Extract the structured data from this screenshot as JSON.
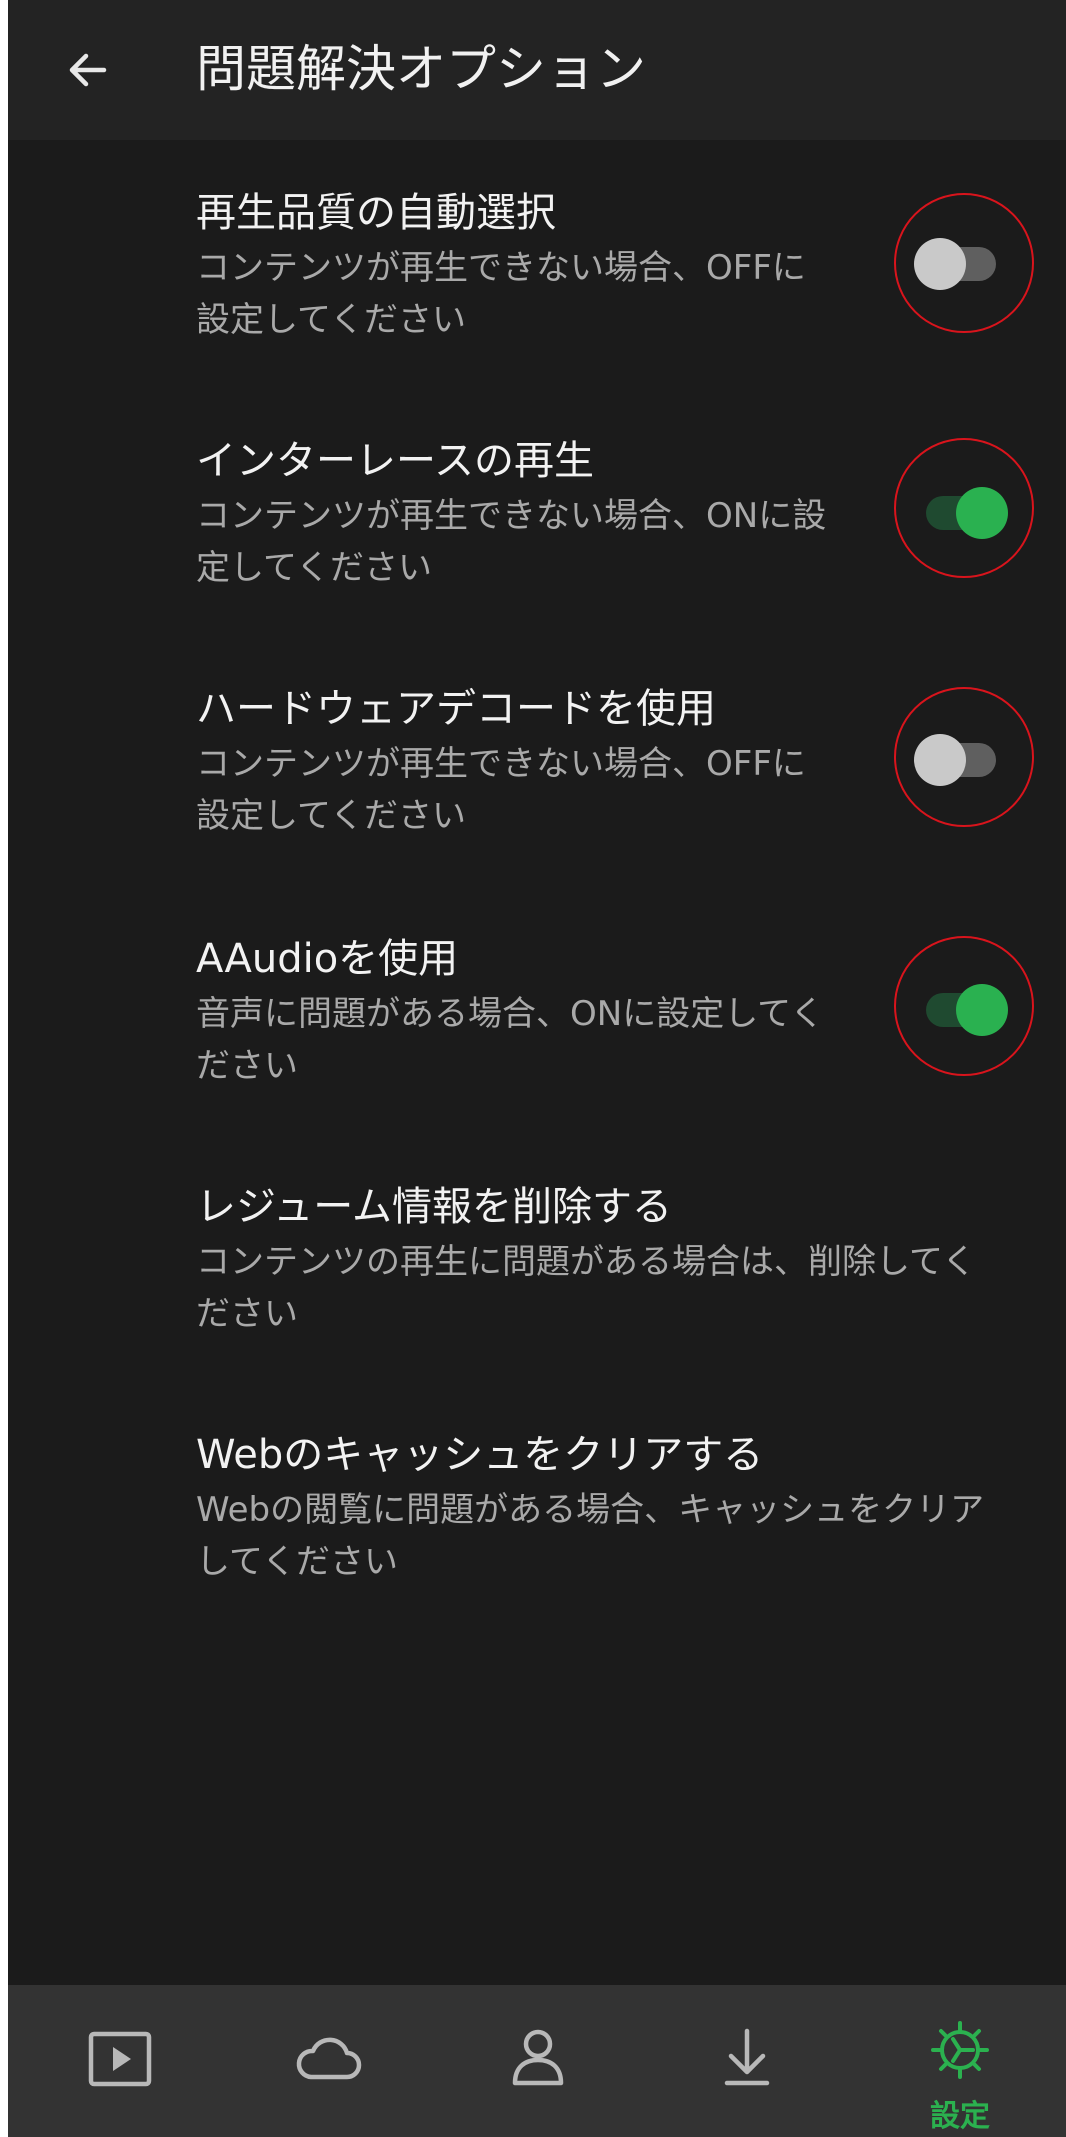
{
  "header": {
    "title": "問題解決オプション",
    "back_icon": "arrow-left-icon"
  },
  "settings": [
    {
      "label": "再生品質の自動選択",
      "description": "コンテンツが再生できない場合、OFFに設定してください",
      "toggle": "off"
    },
    {
      "label": "インターレースの再生",
      "description": "コンテンツが再生できない場合、ONに設定してください",
      "toggle": "on"
    },
    {
      "label": "ハードウェアデコードを使用",
      "description": "コンテンツが再生できない場合、OFFに設定してください",
      "toggle": "off"
    },
    {
      "label": "AAudioを使用",
      "description": "音声に問題がある場合、ONに設定してください",
      "toggle": "on"
    },
    {
      "label": "レジューム情報を削除する",
      "description": "コンテンツの再生に問題がある場合は、削除してください"
    },
    {
      "label": "Webのキャッシュをクリアする",
      "description": "Webの閲覧に問題がある場合、キャッシュをクリアしてください"
    }
  ],
  "bottom_nav": {
    "items": [
      {
        "icon": "play-icon"
      },
      {
        "icon": "cloud-icon"
      },
      {
        "icon": "person-icon"
      },
      {
        "icon": "download-icon"
      },
      {
        "icon": "settings-gear-icon",
        "label": "設定",
        "active": true
      }
    ]
  },
  "colors": {
    "accent": "#2ab150",
    "background": "#1b1b1b",
    "annotation_ring": "#d9141c"
  }
}
